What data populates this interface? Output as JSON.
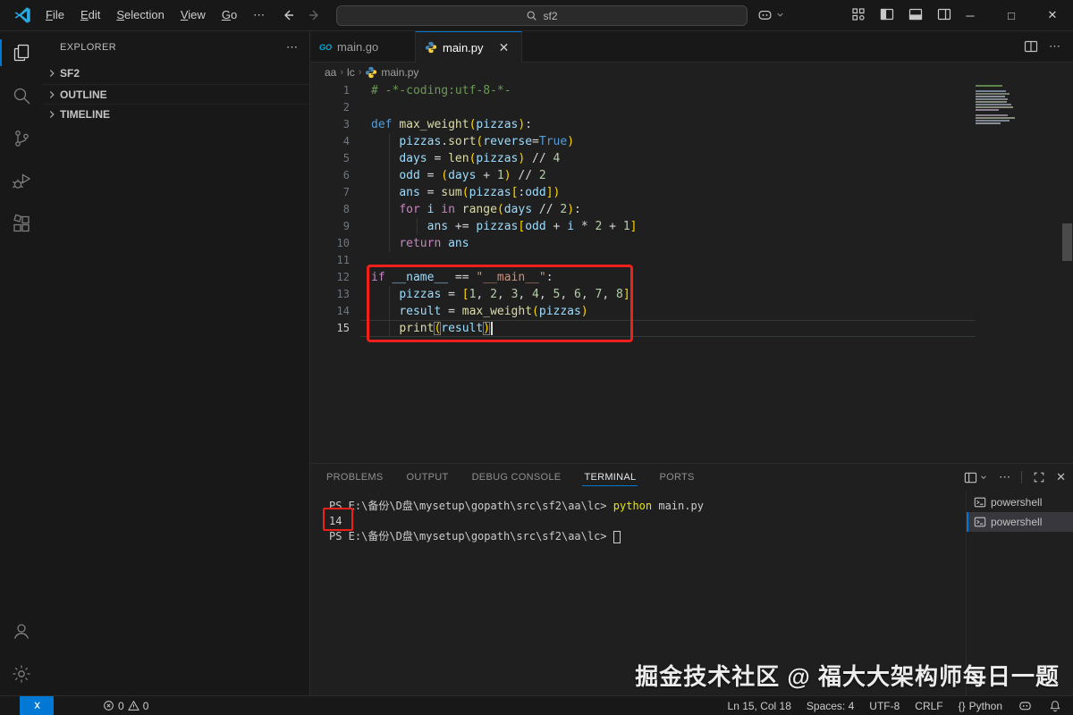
{
  "titlebar": {
    "menus": [
      "File",
      "Edit",
      "Selection",
      "View",
      "Go"
    ],
    "menu_overflow": "⋯",
    "search_value": "sf2"
  },
  "sidebar": {
    "title": "EXPLORER",
    "more": "⋯",
    "sections": [
      {
        "label": "SF2"
      },
      {
        "label": "OUTLINE"
      },
      {
        "label": "TIMELINE"
      }
    ]
  },
  "editor_tabs": [
    {
      "label": "main.go",
      "icon": "go",
      "active": false
    },
    {
      "label": "main.py",
      "icon": "python",
      "active": true
    }
  ],
  "breadcrumb": [
    "aa",
    "lc",
    "main.py"
  ],
  "editor": {
    "active_line": 15,
    "lines": [
      {
        "n": 1,
        "tokens": [
          [
            "cm",
            "# -*-coding:utf-8-*-"
          ]
        ]
      },
      {
        "n": 2,
        "tokens": []
      },
      {
        "n": 3,
        "tokens": [
          [
            "k",
            "def"
          ],
          [
            "t",
            " "
          ],
          [
            "f",
            "max_weight"
          ],
          [
            "b",
            "("
          ],
          [
            "v",
            "pizzas"
          ],
          [
            "b",
            ")"
          ],
          [
            "o",
            ":"
          ]
        ]
      },
      {
        "n": 4,
        "tokens": [
          [
            "t",
            "    "
          ],
          [
            "v",
            "pizzas"
          ],
          [
            "o",
            "."
          ],
          [
            "f",
            "sort"
          ],
          [
            "b",
            "("
          ],
          [
            "v",
            "reverse"
          ],
          [
            "o",
            "="
          ],
          [
            "k",
            "True"
          ],
          [
            "b",
            ")"
          ]
        ]
      },
      {
        "n": 5,
        "tokens": [
          [
            "t",
            "    "
          ],
          [
            "v",
            "days"
          ],
          [
            "o",
            " = "
          ],
          [
            "f",
            "len"
          ],
          [
            "b",
            "("
          ],
          [
            "v",
            "pizzas"
          ],
          [
            "b",
            ")"
          ],
          [
            "o",
            " // "
          ],
          [
            "n2",
            "4"
          ]
        ]
      },
      {
        "n": 6,
        "tokens": [
          [
            "t",
            "    "
          ],
          [
            "v",
            "odd"
          ],
          [
            "o",
            " = "
          ],
          [
            "b",
            "("
          ],
          [
            "v",
            "days"
          ],
          [
            "o",
            " + "
          ],
          [
            "n2",
            "1"
          ],
          [
            "b",
            ")"
          ],
          [
            "o",
            " // "
          ],
          [
            "n2",
            "2"
          ]
        ]
      },
      {
        "n": 7,
        "tokens": [
          [
            "t",
            "    "
          ],
          [
            "v",
            "ans"
          ],
          [
            "o",
            " = "
          ],
          [
            "f",
            "sum"
          ],
          [
            "b",
            "("
          ],
          [
            "v",
            "pizzas"
          ],
          [
            "b",
            "["
          ],
          [
            "o",
            ":"
          ],
          [
            "v",
            "odd"
          ],
          [
            "b",
            "]"
          ],
          [
            "b",
            ")"
          ]
        ]
      },
      {
        "n": 8,
        "tokens": [
          [
            "t",
            "    "
          ],
          [
            "c",
            "for"
          ],
          [
            "t",
            " "
          ],
          [
            "v",
            "i"
          ],
          [
            "t",
            " "
          ],
          [
            "c",
            "in"
          ],
          [
            "t",
            " "
          ],
          [
            "f",
            "range"
          ],
          [
            "b",
            "("
          ],
          [
            "v",
            "days"
          ],
          [
            "o",
            " // "
          ],
          [
            "n2",
            "2"
          ],
          [
            "b",
            ")"
          ],
          [
            "o",
            ":"
          ]
        ]
      },
      {
        "n": 9,
        "tokens": [
          [
            "t",
            "        "
          ],
          [
            "v",
            "ans"
          ],
          [
            "o",
            " += "
          ],
          [
            "v",
            "pizzas"
          ],
          [
            "b",
            "["
          ],
          [
            "v",
            "odd"
          ],
          [
            "o",
            " + "
          ],
          [
            "v",
            "i"
          ],
          [
            "o",
            " * "
          ],
          [
            "n2",
            "2"
          ],
          [
            "o",
            " + "
          ],
          [
            "n2",
            "1"
          ],
          [
            "b",
            "]"
          ]
        ]
      },
      {
        "n": 10,
        "tokens": [
          [
            "t",
            "    "
          ],
          [
            "c",
            "return"
          ],
          [
            "t",
            " "
          ],
          [
            "v",
            "ans"
          ]
        ]
      },
      {
        "n": 11,
        "tokens": []
      },
      {
        "n": 12,
        "tokens": [
          [
            "c",
            "if"
          ],
          [
            "t",
            " "
          ],
          [
            "v",
            "__name__"
          ],
          [
            "o",
            " == "
          ],
          [
            "s",
            "\"__main__\""
          ],
          [
            "o",
            ":"
          ]
        ]
      },
      {
        "n": 13,
        "tokens": [
          [
            "t",
            "    "
          ],
          [
            "v",
            "pizzas"
          ],
          [
            "o",
            " = "
          ],
          [
            "b",
            "["
          ],
          [
            "n2",
            "1"
          ],
          [
            "o",
            ", "
          ],
          [
            "n2",
            "2"
          ],
          [
            "o",
            ", "
          ],
          [
            "n2",
            "3"
          ],
          [
            "o",
            ", "
          ],
          [
            "n2",
            "4"
          ],
          [
            "o",
            ", "
          ],
          [
            "n2",
            "5"
          ],
          [
            "o",
            ", "
          ],
          [
            "n2",
            "6"
          ],
          [
            "o",
            ", "
          ],
          [
            "n2",
            "7"
          ],
          [
            "o",
            ", "
          ],
          [
            "n2",
            "8"
          ],
          [
            "b",
            "]"
          ]
        ]
      },
      {
        "n": 14,
        "tokens": [
          [
            "t",
            "    "
          ],
          [
            "v",
            "result"
          ],
          [
            "o",
            " = "
          ],
          [
            "f",
            "max_weight"
          ],
          [
            "b",
            "("
          ],
          [
            "v",
            "pizzas"
          ],
          [
            "b",
            ")"
          ]
        ]
      },
      {
        "n": 15,
        "tokens": [
          [
            "t",
            "    "
          ],
          [
            "f",
            "print"
          ],
          [
            "m",
            "("
          ],
          [
            "v",
            "result"
          ],
          [
            "m",
            ")"
          ],
          [
            "cur",
            ""
          ]
        ]
      }
    ]
  },
  "panel": {
    "tabs": [
      "PROBLEMS",
      "OUTPUT",
      "DEBUG CONSOLE",
      "TERMINAL",
      "PORTS"
    ],
    "active_tab": "TERMINAL",
    "terminal_lines": [
      [
        [
          "p",
          "PS E:\\备份\\D盘\\mysetup\\gopath\\src\\sf2\\aa\\lc>"
        ],
        [
          "y",
          " python"
        ],
        [
          "w",
          " main.py"
        ]
      ],
      [
        [
          "w",
          "14"
        ]
      ],
      [
        [
          "p",
          "PS E:\\备份\\D盘\\mysetup\\gopath\\src\\sf2\\aa\\lc> "
        ],
        [
          "cur",
          ""
        ]
      ]
    ],
    "terminal_list": [
      {
        "label": "powershell",
        "selected": false
      },
      {
        "label": "powershell",
        "selected": true
      }
    ]
  },
  "status_bar": {
    "errors": "0",
    "warnings": "0",
    "right_items": [
      {
        "name": "line-col-indicator",
        "label": "Ln 15, Col 18"
      },
      {
        "name": "indentation-indicator",
        "label": "Spaces: 4"
      },
      {
        "name": "encoding-indicator",
        "label": "UTF-8"
      },
      {
        "name": "eol-indicator",
        "label": "CRLF"
      },
      {
        "name": "language-indicator",
        "label": "Python",
        "icon": "{}"
      }
    ]
  },
  "watermark": "掘金技术社区 @ 福大大架构师每日一题",
  "colors": {
    "accent": "#0078d4",
    "annotation": "#ee2019",
    "editor_bg": "#1f1f1f",
    "chrome_bg": "#181818",
    "terminal_command_yellow": "#e5e510"
  }
}
